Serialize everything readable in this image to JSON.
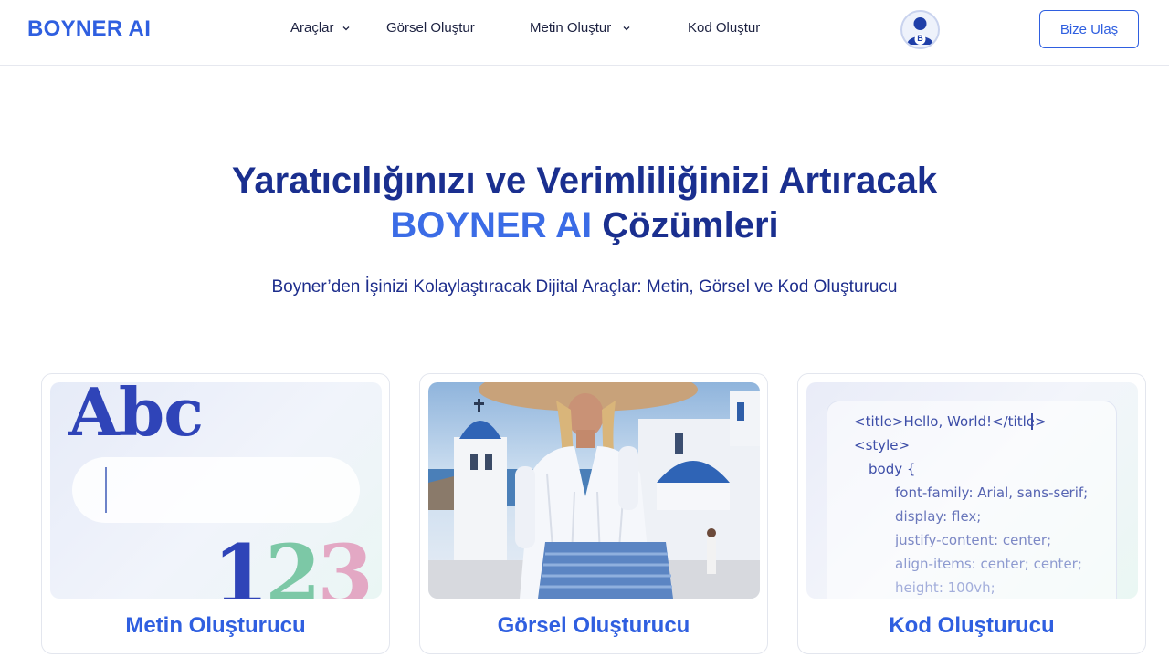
{
  "header": {
    "logo": "BOYNER AI",
    "nav": [
      {
        "label": "Araçlar",
        "has_dropdown": true
      },
      {
        "label": "Görsel Oluştur",
        "has_dropdown": false
      },
      {
        "label": "Metin Oluştur",
        "has_dropdown": true
      },
      {
        "label": "Kod Oluştur",
        "has_dropdown": false
      }
    ],
    "avatar_letter": "B",
    "cta_label": "Bize Ulaş"
  },
  "hero": {
    "title_line1": "Yaratıcılığınızı ve Verimliliğinizi Artıracak",
    "title_accent": "BOYNER AI",
    "title_rest": "Çözümleri",
    "subtitle": "Boyner’den İşinizi Kolaylaştıracak Dijital Araçlar: Metin, Görsel ve Kod Oluşturucu"
  },
  "cards": [
    {
      "label": "Metin Oluşturucu",
      "art": {
        "letters": "Abc",
        "digits": [
          "1",
          "2",
          "3"
        ]
      }
    },
    {
      "label": "Görsel Oluşturucu"
    },
    {
      "label": "Kod Oluşturucu",
      "code_lines": [
        "<title>Hello, World!</title>",
        "<style>",
        "body {",
        "font-family:  Arial, sans-serif;",
        "display:  flex;",
        "justify-content:  center;",
        "align-items: center;  center;",
        "height: 100vh;"
      ]
    }
  ],
  "colors": {
    "brand": "#2f5fe0",
    "title": "#1a2f8f",
    "accent": "#3b6ce6",
    "code_text": "#3d4ea8",
    "code_faded": "#8e9bd0"
  }
}
